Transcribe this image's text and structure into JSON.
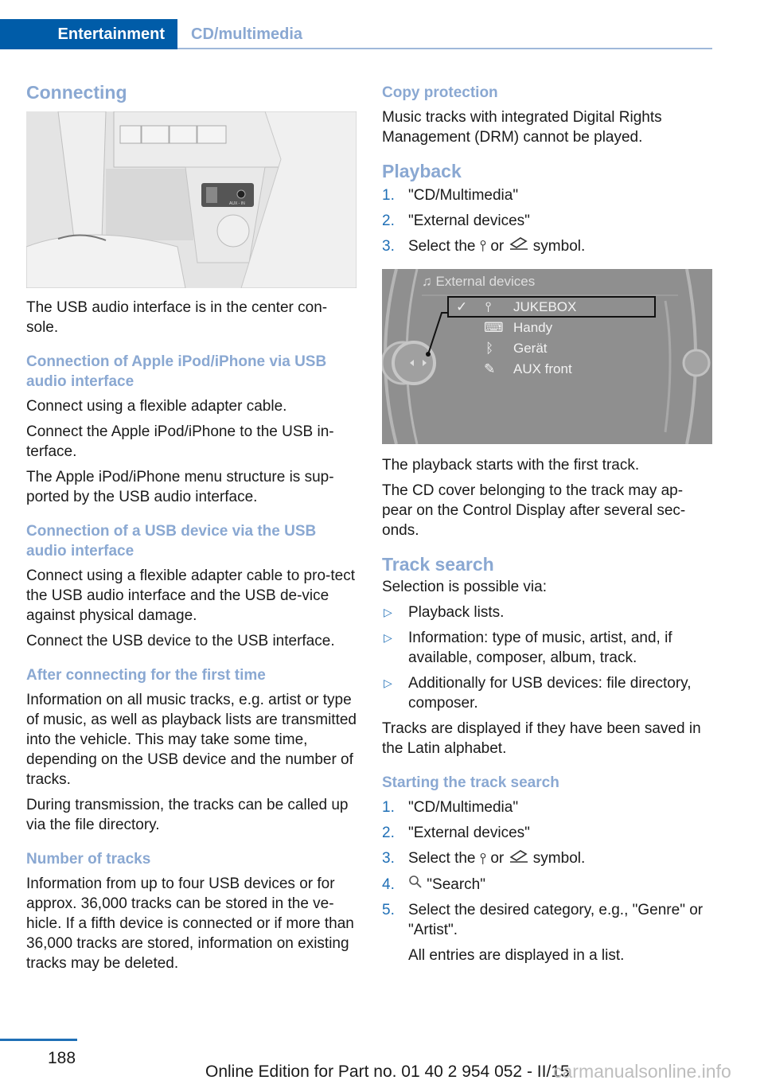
{
  "header": {
    "chapter": "Entertainment",
    "section": "CD/multimedia"
  },
  "left": {
    "title": "Connecting",
    "image_alt": "Center console with USB port and AUX-IN socket",
    "image_labels": {
      "aux": "AUX - IN"
    },
    "intro": "The USB audio interface is in the center con-sole.",
    "sections": [
      {
        "heading": "Connection of Apple iPod/iPhone via USB audio interface",
        "paragraphs": [
          "Connect using a flexible adapter cable.",
          "Connect the Apple iPod/iPhone to the USB in-terface.",
          "The Apple iPod/iPhone menu structure is sup-ported by the USB audio interface."
        ]
      },
      {
        "heading": "Connection of a USB device via the USB audio interface",
        "paragraphs": [
          "Connect using a flexible adapter cable to pro-tect the USB audio interface and the USB de-vice against physical damage.",
          "Connect the USB device to the USB interface."
        ]
      },
      {
        "heading": "After connecting for the first time",
        "paragraphs": [
          "Information on all music tracks, e.g. artist or type of music, as well as playback lists are transmitted into the vehicle. This may take some time, depending on the USB device and the number of tracks.",
          "During transmission, the tracks can be called up via the file directory."
        ]
      },
      {
        "heading": "Number of tracks",
        "paragraphs": [
          "Information from up to four USB devices or for approx. 36,000 tracks can be stored in the ve-hicle. If a fifth device is connected or if more than 36,000 tracks are stored, information on existing tracks may be deleted."
        ]
      }
    ]
  },
  "right": {
    "copy": {
      "heading": "Copy protection",
      "text": "Music tracks with integrated Digital Rights Management (DRM) cannot be played."
    },
    "playback": {
      "title": "Playback",
      "steps": [
        {
          "n": "1.",
          "text": "\"CD/Multimedia\""
        },
        {
          "n": "2.",
          "text": "\"External devices\""
        },
        {
          "n": "3.",
          "pre": "Select the",
          "mid": "or",
          "post": "symbol."
        }
      ],
      "after": [
        "The playback starts with the first track.",
        "The CD cover belonging to the track may ap-pear on the Control Display after several sec-onds."
      ]
    },
    "screen": {
      "title": "External devices",
      "items": [
        {
          "label": "JUKEBOX",
          "icon": "usb-icon",
          "checked": true,
          "selected": true
        },
        {
          "label": "Handy",
          "icon": "phone-icon",
          "checked": false,
          "selected": false
        },
        {
          "label": "Gerät",
          "icon": "bluetooth-icon",
          "checked": false,
          "selected": false
        },
        {
          "label": "AUX front",
          "icon": "aux-plug-icon",
          "checked": false,
          "selected": false
        }
      ]
    },
    "track_search": {
      "title": "Track search",
      "intro": "Selection is possible via:",
      "bullets": [
        "Playback lists.",
        "Information: type of music, artist, and, if available, composer, album, track.",
        "Additionally for USB devices: file directory, composer."
      ],
      "note": "Tracks are displayed if they have been saved in the Latin alphabet."
    },
    "starting": {
      "heading": "Starting the track search",
      "steps": [
        {
          "n": "1.",
          "text": "\"CD/Multimedia\""
        },
        {
          "n": "2.",
          "text": "\"External devices\""
        },
        {
          "n": "3.",
          "pre": "Select the",
          "mid": "or",
          "post": "symbol."
        },
        {
          "n": "4.",
          "text": "\"Search\""
        },
        {
          "n": "5.",
          "text": "Select the desired category, e.g., \"Genre\" or \"Artist\"."
        }
      ],
      "final": "All entries are displayed in a list."
    }
  },
  "footer": {
    "page": "188",
    "edition": "Online Edition for Part no. 01 40 2 954 052 - II/15",
    "watermark": "carmanualsonline.info"
  }
}
